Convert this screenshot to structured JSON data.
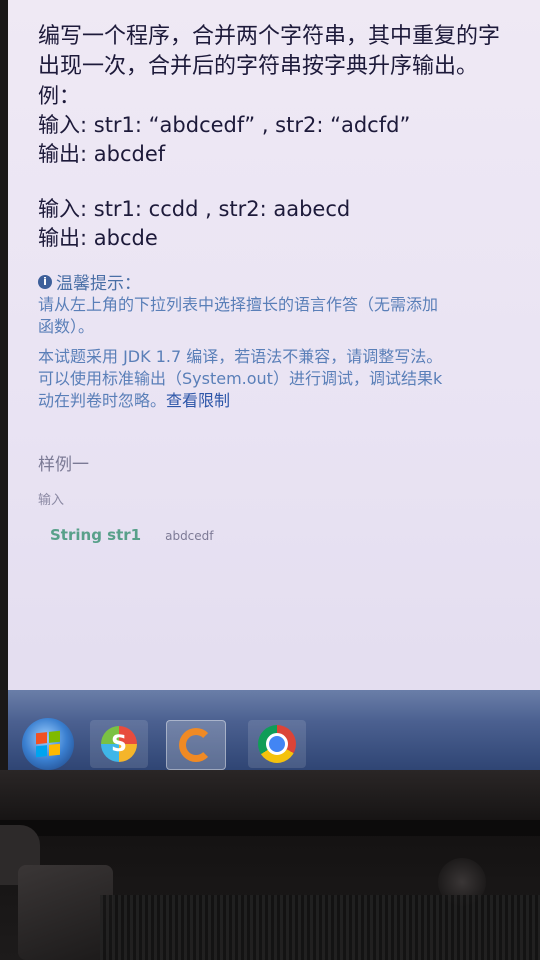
{
  "question": {
    "line1": "编写一个程序，合并两个字符串，其中重复的字",
    "line2": "出现一次，合并后的字符串按字典升序输出。",
    "example_label": "例：",
    "ex1_input": "输入: str1:  “abdcedf”  , str2:  “adcfd”",
    "ex1_output": "输出: abcdef",
    "ex2_input": "输入: str1: ccdd , str2: aabecd",
    "ex2_output": "输出: abcde"
  },
  "tip": {
    "icon": "info-icon",
    "title": "温馨提示：",
    "line1": "请从左上角的下拉列表中选择擅长的语言作答（无需添加",
    "line2": "函数）。",
    "line3": "本试题采用 JDK 1.7 编译，若语法不兼容，请调整写法。",
    "line4": "可以使用标准输出（System.out）进行调试，调试结果k",
    "line5": "动在判卷时忽略。",
    "limit_link": "查看限制"
  },
  "sample": {
    "title": "样例一",
    "subtitle": "输入",
    "param_name": "String str1",
    "param_value": "abdcedf"
  },
  "taskbar": {
    "start": "windows-start-icon",
    "apps": [
      "sogou-icon",
      "app-orange-icon",
      "chrome-icon"
    ]
  }
}
